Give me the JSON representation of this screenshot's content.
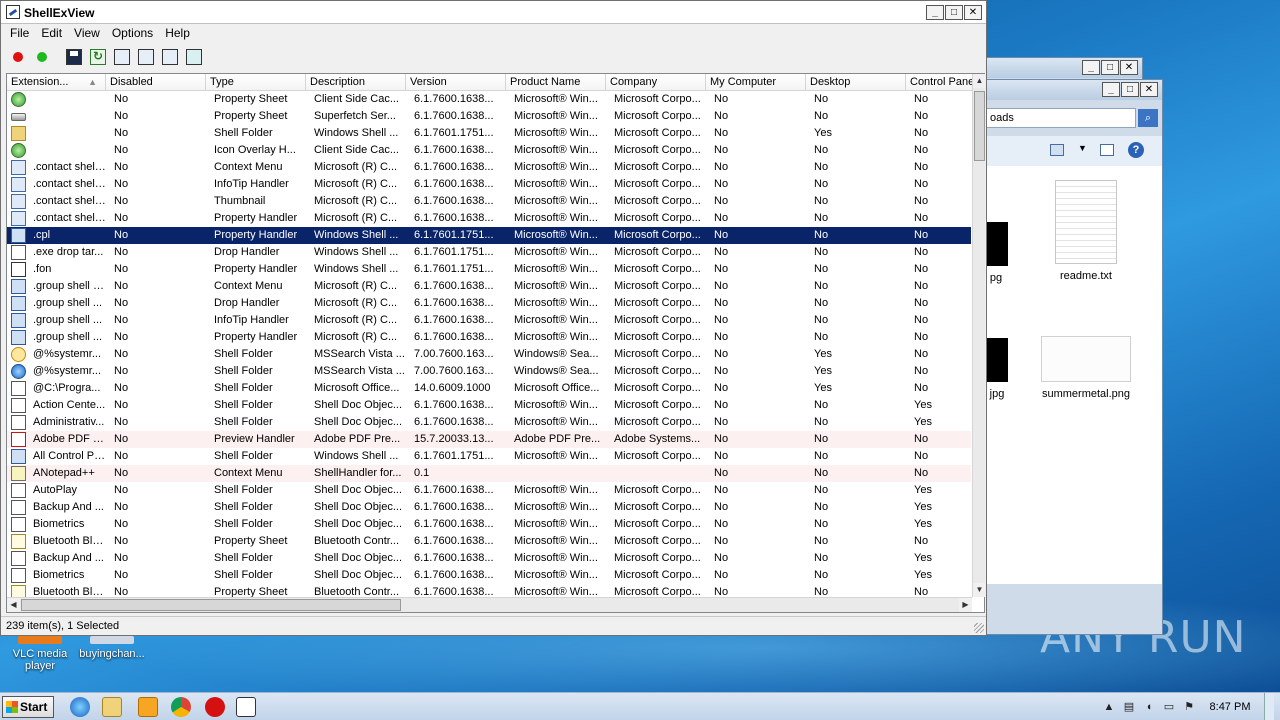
{
  "window": {
    "title": "ShellExView"
  },
  "menu": [
    "File",
    "Edit",
    "View",
    "Options",
    "Help"
  ],
  "columns": [
    "Extension...",
    "Disabled",
    "Type",
    "Description",
    "Version",
    "Product Name",
    "Company",
    "My Computer",
    "Desktop",
    "Control Panel"
  ],
  "rows": [
    {
      "icon": "green-circle-icon",
      "ext": "",
      "dis": "No",
      "type": "Property Sheet",
      "desc": "Client Side Cac...",
      "ver": "6.1.7600.1638...",
      "prod": "Microsoft® Win...",
      "comp": "Microsoft Corpo...",
      "mc": "No",
      "desk": "No",
      "cp": "No"
    },
    {
      "icon": "drive-icon",
      "ext": "",
      "dis": "No",
      "type": "Property Sheet",
      "desc": "Superfetch Ser...",
      "ver": "6.1.7600.1638...",
      "prod": "Microsoft® Win...",
      "comp": "Microsoft Corpo...",
      "mc": "No",
      "desk": "No",
      "cp": "No"
    },
    {
      "icon": "folder-icon",
      "ext": "",
      "dis": "No",
      "type": "Shell Folder",
      "desc": "Windows Shell ...",
      "ver": "6.1.7601.1751...",
      "prod": "Microsoft® Win...",
      "comp": "Microsoft Corpo...",
      "mc": "No",
      "desk": "Yes",
      "cp": "No"
    },
    {
      "icon": "green-circle-icon",
      "ext": "",
      "dis": "No",
      "type": "Icon Overlay H...",
      "desc": "Client Side Cac...",
      "ver": "6.1.7600.1638...",
      "prod": "Microsoft® Win...",
      "comp": "Microsoft Corpo...",
      "mc": "No",
      "desk": "No",
      "cp": "No"
    },
    {
      "icon": "contact-card-icon",
      "ext": ".contact shell...",
      "dis": "No",
      "type": "Context Menu",
      "desc": "Microsoft (R) C...",
      "ver": "6.1.7600.1638...",
      "prod": "Microsoft® Win...",
      "comp": "Microsoft Corpo...",
      "mc": "No",
      "desk": "No",
      "cp": "No"
    },
    {
      "icon": "contact-card-icon",
      "ext": ".contact shell...",
      "dis": "No",
      "type": "InfoTip Handler",
      "desc": "Microsoft (R) C...",
      "ver": "6.1.7600.1638...",
      "prod": "Microsoft® Win...",
      "comp": "Microsoft Corpo...",
      "mc": "No",
      "desk": "No",
      "cp": "No"
    },
    {
      "icon": "contact-card-icon",
      "ext": ".contact shell...",
      "dis": "No",
      "type": "Thumbnail",
      "desc": "Microsoft (R) C...",
      "ver": "6.1.7600.1638...",
      "prod": "Microsoft® Win...",
      "comp": "Microsoft Corpo...",
      "mc": "No",
      "desk": "No",
      "cp": "No"
    },
    {
      "icon": "contact-card-icon",
      "ext": ".contact shell...",
      "dis": "No",
      "type": "Property Handler",
      "desc": "Microsoft (R) C...",
      "ver": "6.1.7600.1638...",
      "prod": "Microsoft® Win...",
      "comp": "Microsoft Corpo...",
      "mc": "No",
      "desk": "No",
      "cp": "No"
    },
    {
      "icon": "control-panel-icon",
      "ext": ".cpl",
      "dis": "No",
      "type": "Property Handler",
      "desc": "Windows Shell ...",
      "ver": "6.1.7601.1751...",
      "prod": "Microsoft® Win...",
      "comp": "Microsoft Corpo...",
      "mc": "No",
      "desk": "No",
      "cp": "No",
      "selected": true
    },
    {
      "icon": "application-icon",
      "ext": ".exe drop tar...",
      "dis": "No",
      "type": "Drop Handler",
      "desc": "Windows Shell ...",
      "ver": "6.1.7601.1751...",
      "prod": "Microsoft® Win...",
      "comp": "Microsoft Corpo...",
      "mc": "No",
      "desk": "No",
      "cp": "No"
    },
    {
      "icon": "font-file-icon",
      "ext": ".fon",
      "dis": "No",
      "type": "Property Handler",
      "desc": "Windows Shell ...",
      "ver": "6.1.7601.1751...",
      "prod": "Microsoft® Win...",
      "comp": "Microsoft Corpo...",
      "mc": "No",
      "desk": "No",
      "cp": "No"
    },
    {
      "icon": "group-window-icon",
      "ext": ".group shell c...",
      "dis": "No",
      "type": "Context Menu",
      "desc": "Microsoft (R) C...",
      "ver": "6.1.7600.1638...",
      "prod": "Microsoft® Win...",
      "comp": "Microsoft Corpo...",
      "mc": "No",
      "desk": "No",
      "cp": "No"
    },
    {
      "icon": "group-window-icon",
      "ext": ".group shell ...",
      "dis": "No",
      "type": "Drop Handler",
      "desc": "Microsoft (R) C...",
      "ver": "6.1.7600.1638...",
      "prod": "Microsoft® Win...",
      "comp": "Microsoft Corpo...",
      "mc": "No",
      "desk": "No",
      "cp": "No"
    },
    {
      "icon": "group-window-icon",
      "ext": ".group shell ...",
      "dis": "No",
      "type": "InfoTip Handler",
      "desc": "Microsoft (R) C...",
      "ver": "6.1.7600.1638...",
      "prod": "Microsoft® Win...",
      "comp": "Microsoft Corpo...",
      "mc": "No",
      "desk": "No",
      "cp": "No"
    },
    {
      "icon": "group-window-icon",
      "ext": ".group shell ...",
      "dis": "No",
      "type": "Property Handler",
      "desc": "Microsoft (R) C...",
      "ver": "6.1.7600.1638...",
      "prod": "Microsoft® Win...",
      "comp": "Microsoft Corpo...",
      "mc": "No",
      "desk": "No",
      "cp": "No"
    },
    {
      "icon": "search-folder-icon",
      "ext": "@%systemr...",
      "dis": "No",
      "type": "Shell Folder",
      "desc": "MSSearch Vista ...",
      "ver": "7.00.7600.163...",
      "prod": "Windows® Sea...",
      "comp": "Microsoft Corpo...",
      "mc": "No",
      "desk": "Yes",
      "cp": "No"
    },
    {
      "icon": "globe-icon",
      "ext": "@%systemr...",
      "dis": "No",
      "type": "Shell Folder",
      "desc": "MSSearch Vista ...",
      "ver": "7.00.7600.163...",
      "prod": "Windows® Sea...",
      "comp": "Microsoft Corpo...",
      "mc": "No",
      "desk": "Yes",
      "cp": "No"
    },
    {
      "icon": "application-icon",
      "ext": "@C:\\Progra...",
      "dis": "No",
      "type": "Shell Folder",
      "desc": "Microsoft Office...",
      "ver": "14.0.6009.1000",
      "prod": "Microsoft Office...",
      "comp": "Microsoft Corpo...",
      "mc": "No",
      "desk": "Yes",
      "cp": "No"
    },
    {
      "icon": "application-icon",
      "ext": "Action Cente...",
      "dis": "No",
      "type": "Shell Folder",
      "desc": "Shell Doc Objec...",
      "ver": "6.1.7600.1638...",
      "prod": "Microsoft® Win...",
      "comp": "Microsoft Corpo...",
      "mc": "No",
      "desk": "No",
      "cp": "Yes"
    },
    {
      "icon": "application-icon",
      "ext": "Administrativ...",
      "dis": "No",
      "type": "Shell Folder",
      "desc": "Shell Doc Objec...",
      "ver": "6.1.7600.1638...",
      "prod": "Microsoft® Win...",
      "comp": "Microsoft Corpo...",
      "mc": "No",
      "desk": "No",
      "cp": "Yes"
    },
    {
      "icon": "pdf-icon",
      "ext": "Adobe PDF P...",
      "dis": "No",
      "type": "Preview Handler",
      "desc": "Adobe PDF Pre...",
      "ver": "15.7.20033.13...",
      "prod": "Adobe PDF Pre...",
      "comp": "Adobe Systems...",
      "mc": "No",
      "desk": "No",
      "cp": "No",
      "pink": true
    },
    {
      "icon": "control-panel-icon",
      "ext": "All Control Pa...",
      "dis": "No",
      "type": "Shell Folder",
      "desc": "Windows Shell ...",
      "ver": "6.1.7601.1751...",
      "prod": "Microsoft® Win...",
      "comp": "Microsoft Corpo...",
      "mc": "No",
      "desk": "No",
      "cp": "No"
    },
    {
      "icon": "notepad-icon",
      "ext": "ANotepad++",
      "dis": "No",
      "type": "Context Menu",
      "desc": "ShellHandler for...",
      "ver": "0.1",
      "prod": "",
      "comp": "",
      "mc": "No",
      "desk": "No",
      "cp": "No",
      "pink": true
    },
    {
      "icon": "application-icon",
      "ext": "AutoPlay",
      "dis": "No",
      "type": "Shell Folder",
      "desc": "Shell Doc Objec...",
      "ver": "6.1.7600.1638...",
      "prod": "Microsoft® Win...",
      "comp": "Microsoft Corpo...",
      "mc": "No",
      "desk": "No",
      "cp": "Yes"
    },
    {
      "icon": "application-icon",
      "ext": "Backup And ...",
      "dis": "No",
      "type": "Shell Folder",
      "desc": "Shell Doc Objec...",
      "ver": "6.1.7600.1638...",
      "prod": "Microsoft® Win...",
      "comp": "Microsoft Corpo...",
      "mc": "No",
      "desk": "No",
      "cp": "Yes"
    },
    {
      "icon": "application-icon",
      "ext": "Biometrics",
      "dis": "No",
      "type": "Shell Folder",
      "desc": "Shell Doc Objec...",
      "ver": "6.1.7600.1638...",
      "prod": "Microsoft® Win...",
      "comp": "Microsoft Corpo...",
      "mc": "No",
      "desk": "No",
      "cp": "Yes"
    },
    {
      "icon": "bluetooth-icon",
      "ext": "Bluetooth Blu...",
      "dis": "No",
      "type": "Property Sheet",
      "desc": "Bluetooth Contr...",
      "ver": "6.1.7600.1638...",
      "prod": "Microsoft® Win...",
      "comp": "Microsoft Corpo...",
      "mc": "No",
      "desk": "No",
      "cp": "No"
    },
    {
      "icon": "application-icon",
      "ext": "Backup And ...",
      "dis": "No",
      "type": "Shell Folder",
      "desc": "Shell Doc Objec...",
      "ver": "6.1.7600.1638...",
      "prod": "Microsoft® Win...",
      "comp": "Microsoft Corpo...",
      "mc": "No",
      "desk": "No",
      "cp": "Yes"
    },
    {
      "icon": "application-icon",
      "ext": "Biometrics",
      "dis": "No",
      "type": "Shell Folder",
      "desc": "Shell Doc Objec...",
      "ver": "6.1.7600.1638...",
      "prod": "Microsoft® Win...",
      "comp": "Microsoft Corpo...",
      "mc": "No",
      "desk": "No",
      "cp": "Yes"
    },
    {
      "icon": "bluetooth-icon",
      "ext": "Bluetooth Blu...",
      "dis": "No",
      "type": "Property Sheet",
      "desc": "Bluetooth Contr...",
      "ver": "6.1.7600.1638...",
      "prod": "Microsoft® Win...",
      "comp": "Microsoft Corpo...",
      "mc": "No",
      "desk": "No",
      "cp": "No"
    }
  ],
  "status": {
    "text": "239 item(s), 1 Selected"
  },
  "explorer": {
    "address_fragment": "oads",
    "files": [
      {
        "name": "readme.txt"
      },
      {
        "name": "summermetal.png"
      },
      {
        "name": "pg"
      },
      {
        "name": "jpg"
      }
    ]
  },
  "desktop": {
    "icons": [
      {
        "label": "VLC media player"
      },
      {
        "label": "buyingchan..."
      }
    ],
    "watermark": "ANY RUN"
  },
  "taskbar": {
    "start_label": "Start",
    "clock": "8:47 PM"
  },
  "colors": {
    "selection": "#0a246a",
    "disabled_row": "#fdf0f0",
    "desktop_blue": "#1a78c2"
  }
}
